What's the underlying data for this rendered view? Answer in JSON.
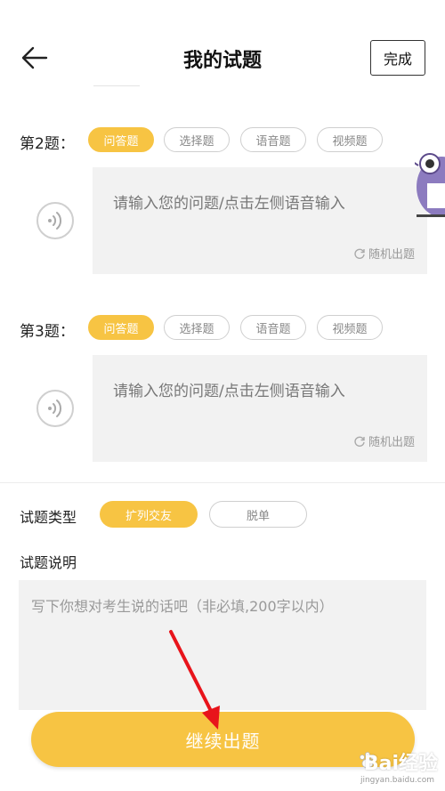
{
  "header": {
    "title": "我的试题",
    "done_label": "完成",
    "back_icon": "arrow-left-icon"
  },
  "questions": [
    {
      "label": "第2题：",
      "types": [
        "问答题",
        "选择题",
        "语音题",
        "视频题"
      ],
      "selected_type": "问答题",
      "placeholder": "请输入您的问题/点击左侧语音输入",
      "random_label": "随机出题"
    },
    {
      "label": "第3题：",
      "types": [
        "问答题",
        "选择题",
        "语音题",
        "视频题"
      ],
      "selected_type": "问答题",
      "placeholder": "请输入您的问题/点击左侧语音输入",
      "random_label": "随机出题"
    }
  ],
  "question_type": {
    "label": "试题类型",
    "options": [
      "扩列交友",
      "脱单"
    ],
    "selected": "扩列交友"
  },
  "description": {
    "label": "试题说明",
    "placeholder": "写下你想对考生说的话吧（非必填,200字以内）"
  },
  "continue_label": "继续出题",
  "watermark": {
    "main": "Bai经验",
    "sub": "jingyan.baidu.com"
  },
  "colors": {
    "accent": "#f7c443",
    "input_bg": "#f2f2f2",
    "annotation_arrow": "#e8141b"
  }
}
